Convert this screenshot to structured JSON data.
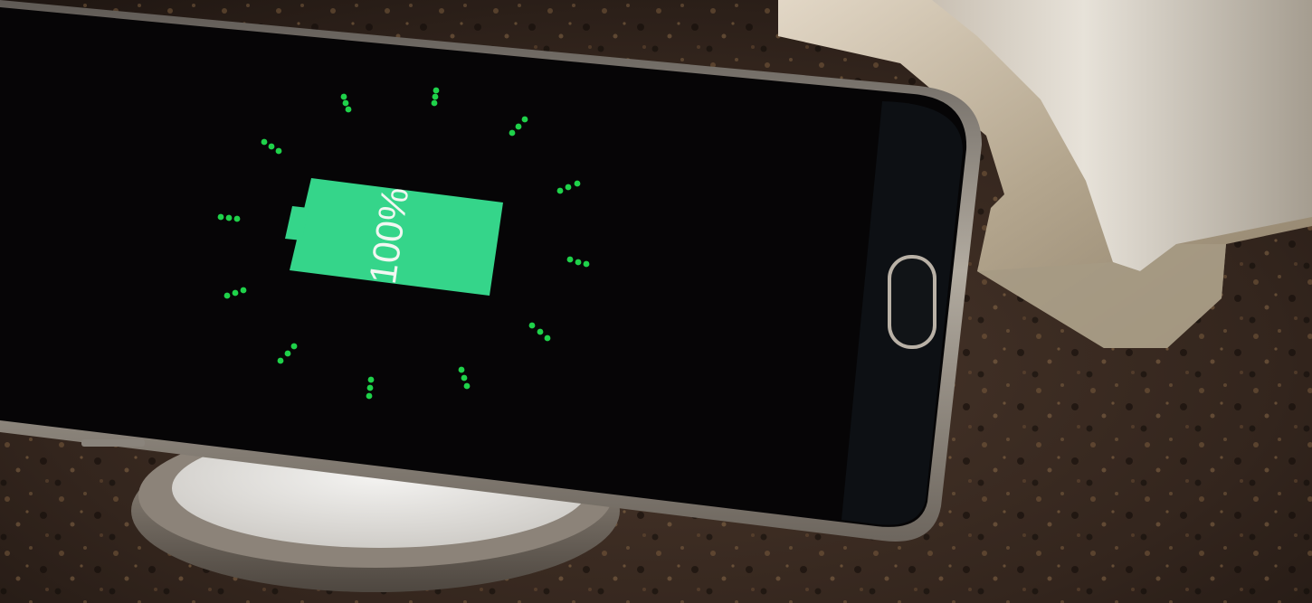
{
  "battery": {
    "percent_label": "100%",
    "level_percent": 100,
    "fill_color": "#35d58a"
  },
  "indicator": {
    "dot_color": "#1fd24a"
  },
  "icons": {
    "battery": "battery-full-icon",
    "home_button": "home-button-icon"
  },
  "colors": {
    "screen": "#060506",
    "phone_frame": "#9c9488",
    "countertop": "#3a2b22",
    "charging_pad_top": "#e8e6e2",
    "charging_pad_rim": "#7f776d",
    "metal_stand": "#b7ab95"
  }
}
